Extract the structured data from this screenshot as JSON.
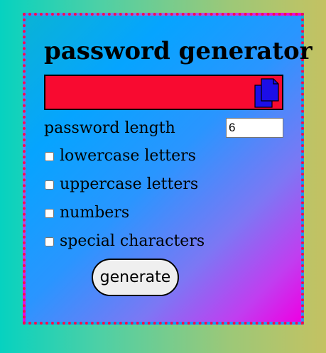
{
  "app": {
    "title": "password generator"
  },
  "output": {
    "password": "",
    "copy_icon": "copy-icon"
  },
  "settings": {
    "length_label": "password length",
    "length_value": "6",
    "options": [
      {
        "label": "lowercase letters",
        "checked": false
      },
      {
        "label": "uppercase letters",
        "checked": false
      },
      {
        "label": "numbers",
        "checked": false
      },
      {
        "label": "special characters",
        "checked": false
      }
    ]
  },
  "actions": {
    "generate_label": "generate"
  },
  "colors": {
    "border": "#ff0a4a",
    "password_box": "#f80a30",
    "copy_icon": "#1c0ee8"
  }
}
